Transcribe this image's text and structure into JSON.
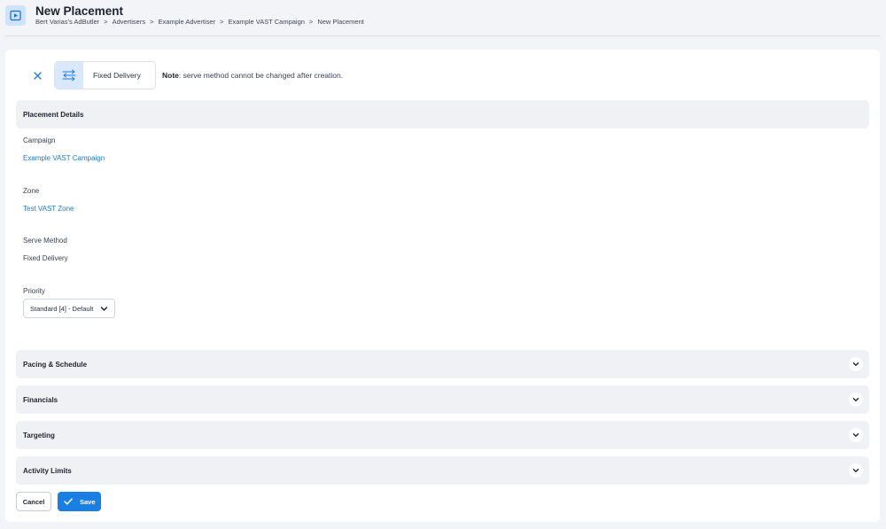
{
  "header": {
    "title": "New Placement",
    "breadcrumb": [
      "Bert Varias's AdButler",
      "Advertisers",
      "Example Advertiser",
      "Example VAST Campaign",
      "New Placement"
    ],
    "breadcrumb_separator": ">",
    "icon": "video-play-icon"
  },
  "serve_method_bar": {
    "close_icon": "close-icon",
    "method_icon": "fixed-delivery-arrows-icon",
    "method_label": "Fixed Delivery",
    "note_prefix": "Note",
    "note_text": ": serve method cannot be changed after creation."
  },
  "placement_details": {
    "title": "Placement Details",
    "campaign_label": "Campaign",
    "campaign_value": "Example VAST Campaign",
    "zone_label": "Zone",
    "zone_value": "Test VAST Zone",
    "serve_method_label": "Serve Method",
    "serve_method_value": "Fixed Delivery",
    "priority_label": "Priority",
    "priority_value": "Standard [4] - Default"
  },
  "collapsed_sections": [
    {
      "title": "Pacing & Schedule"
    },
    {
      "title": "Financials"
    },
    {
      "title": "Targeting"
    },
    {
      "title": "Activity Limits"
    }
  ],
  "actions": {
    "cancel_label": "Cancel",
    "save_label": "Save"
  },
  "colors": {
    "accent": "#1a7fe3",
    "link": "#1e7ad8",
    "section_bg": "#f0f1f5",
    "icon_bg": "#d9e9fb"
  }
}
